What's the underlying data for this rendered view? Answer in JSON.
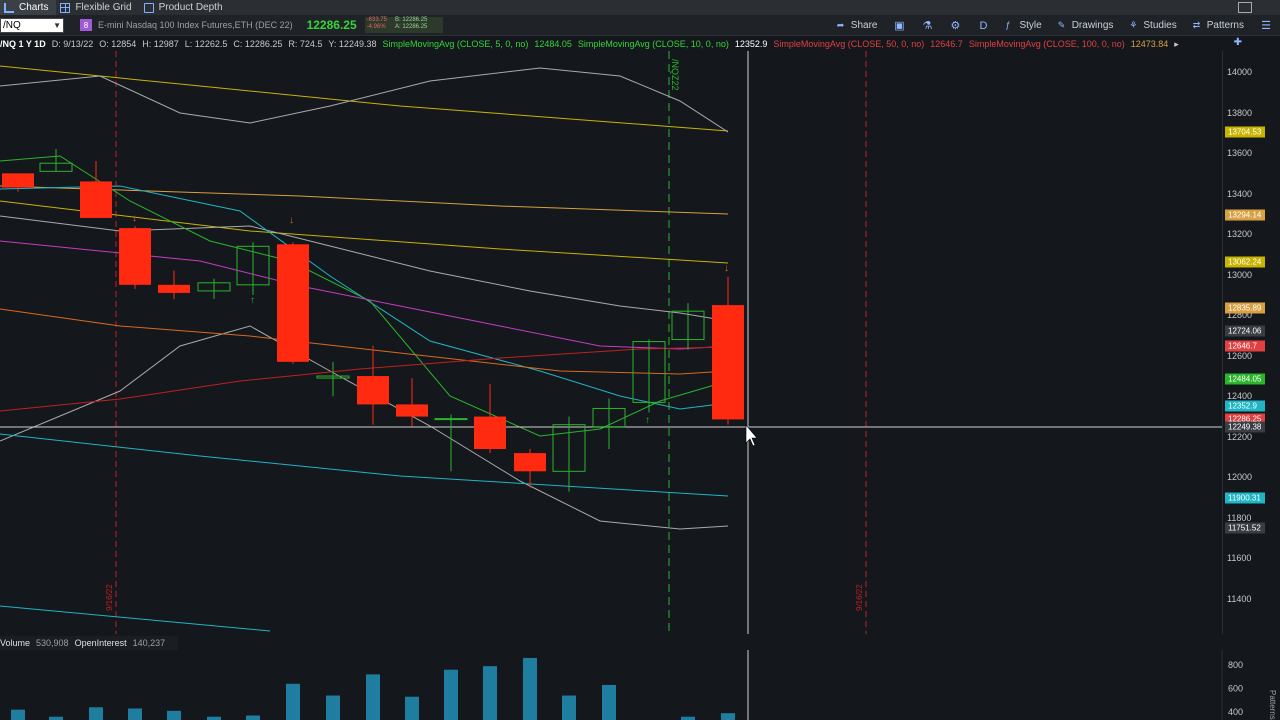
{
  "tabs": [
    {
      "label": "Charts",
      "active": true
    },
    {
      "label": "Flexible Grid",
      "active": false
    },
    {
      "label": "Product Depth",
      "active": false
    }
  ],
  "toolbar": {
    "symbol": "/NQ",
    "link_label": "8",
    "description": "E-mini Nasdaq 100 Index Futures,ETH (DEC 22)",
    "last_price": "12286.25",
    "bid_change_top": "-633.75",
    "bid_change_bottom": "-4.96%",
    "bid": "B: 12286.25",
    "ask": "A: 12286.25",
    "share_label": "Share",
    "period_label": "D",
    "style_label": "Style",
    "drawings_label": "Drawings",
    "studies_label": "Studies",
    "patterns_label": "Patterns"
  },
  "legend": {
    "symbol_period": "/NQ 1 Y 1D",
    "date": "D: 9/13/22",
    "open": "O: 12854",
    "high": "H: 12987",
    "low": "L: 12262.5",
    "close": "C: 12286.25",
    "range": "R: 724.5",
    "ylow": "Y: 12249.38",
    "sma5_label": "SimpleMovingAvg (CLOSE, 5, 0, no)",
    "sma5_value": "12484.05",
    "sma10_label": "SimpleMovingAvg (CLOSE, 10, 0, no)",
    "sma10_value": "12352.9",
    "sma50_label": "SimpleMovingAvg (CLOSE, 50, 0, no)",
    "sma50_value": "12646.7",
    "sma100_label": "SimpleMovingAvg (CLOSE, 100, 0, no)",
    "sma100_value": "12473.84",
    "more": "▸"
  },
  "price_axis": {
    "labels": [
      "14000",
      "13800",
      "13600",
      "13400",
      "13200",
      "13000",
      "12800",
      "12600",
      "12400",
      "12200",
      "12000",
      "11800",
      "11600",
      "11400"
    ],
    "tags": [
      {
        "text": "13704.53",
        "price": 13704.53,
        "color": "#c8b400"
      },
      {
        "text": "13294.14",
        "price": 13294.14,
        "color": "#d8a040"
      },
      {
        "text": "13062.24",
        "price": 13062.24,
        "color": "#c8b400"
      },
      {
        "text": "12835.89",
        "price": 12835.89,
        "color": "#d8a040"
      },
      {
        "text": "12724.06",
        "price": 12724.06,
        "color": "#3a3e44"
      },
      {
        "text": "12646.7",
        "price": 12646.7,
        "color": "#e04040"
      },
      {
        "text": "12484.05",
        "price": 12484.05,
        "color": "#2ab52a"
      },
      {
        "text": "12352.9",
        "price": 12352.9,
        "color": "#1fb5c4"
      },
      {
        "text": "12286.25",
        "price": 12286.25,
        "color": "#e04040"
      },
      {
        "text": "12249.38",
        "price": 12249.38,
        "color": "#3a3e44"
      },
      {
        "text": "11900.31",
        "price": 11900.31,
        "color": "#1fb5c4"
      },
      {
        "text": "11751.52",
        "price": 11751.52,
        "color": "#3a3e44"
      }
    ]
  },
  "markers": {
    "expiry_label": "/NQZ22",
    "date_left": "9/16/22",
    "date_right": "9/16/22"
  },
  "volume": {
    "name": "Volume",
    "value": "530,908",
    "oi_name": "OpenInterest",
    "oi_value": "140,237",
    "axis_labels": [
      "800",
      "600",
      "400"
    ],
    "axis_values": [
      800,
      600,
      400
    ],
    "bars": [
      {
        "pos": 18,
        "v": 420
      },
      {
        "pos": 56,
        "v": 360
      },
      {
        "pos": 96,
        "v": 440
      },
      {
        "pos": 135,
        "v": 430
      },
      {
        "pos": 174,
        "v": 410
      },
      {
        "pos": 214,
        "v": 360
      },
      {
        "pos": 253,
        "v": 370
      },
      {
        "pos": 293,
        "v": 640
      },
      {
        "pos": 333,
        "v": 540
      },
      {
        "pos": 373,
        "v": 720
      },
      {
        "pos": 412,
        "v": 530
      },
      {
        "pos": 451,
        "v": 760
      },
      {
        "pos": 490,
        "v": 790
      },
      {
        "pos": 530,
        "v": 860
      },
      {
        "pos": 569,
        "v": 540
      },
      {
        "pos": 609,
        "v": 630
      },
      {
        "pos": 688,
        "v": 360
      },
      {
        "pos": 728,
        "v": 390
      }
    ],
    "pattern_label": "Patterns"
  },
  "colors": {
    "bull": "#2ab52a",
    "bear": "#ff2a10",
    "sma5": "#2ab52a",
    "sma10": "#1fb5c4",
    "sma50": "#c43cc4",
    "sma100": "#d86a20",
    "volume_bar": "#1f7ea0"
  },
  "candles": [
    {
      "o": 13430,
      "h": 13460,
      "l": 13410,
      "c": 13500,
      "up": false,
      "pos": 18
    },
    {
      "o": 13550,
      "h": 13620,
      "l": 13510,
      "c": 13510,
      "up": true,
      "pos": 56
    },
    {
      "o": 13460,
      "h": 13560,
      "l": 13280,
      "c": 13280,
      "up": false,
      "pos": 96
    },
    {
      "o": 13230,
      "h": 13240,
      "l": 12930,
      "c": 12950,
      "up": false,
      "pos": 135
    },
    {
      "o": 12950,
      "h": 13020,
      "l": 12880,
      "c": 12910,
      "up": false,
      "pos": 174
    },
    {
      "o": 12920,
      "h": 12980,
      "l": 12880,
      "c": 12960,
      "up": true,
      "pos": 214
    },
    {
      "o": 12950,
      "h": 13160,
      "l": 12900,
      "c": 13140,
      "up": true,
      "pos": 253
    },
    {
      "o": 13150,
      "h": 13160,
      "l": 12560,
      "c": 12570,
      "up": false,
      "pos": 293
    },
    {
      "o": 12490,
      "h": 12570,
      "l": 12400,
      "c": 12500,
      "up": true,
      "pos": 333
    },
    {
      "o": 12500,
      "h": 12650,
      "l": 12260,
      "c": 12360,
      "up": false,
      "pos": 373
    },
    {
      "o": 12360,
      "h": 12490,
      "l": 12250,
      "c": 12300,
      "up": false,
      "pos": 412
    },
    {
      "o": 12290,
      "h": 12310,
      "l": 12030,
      "c": 12290,
      "up": true,
      "pos": 451
    },
    {
      "o": 12300,
      "h": 12460,
      "l": 12120,
      "c": 12140,
      "up": false,
      "pos": 490
    },
    {
      "o": 12120,
      "h": 12140,
      "l": 11950,
      "c": 12030,
      "up": false,
      "pos": 530
    },
    {
      "o": 12030,
      "h": 12300,
      "l": 11930,
      "c": 12260,
      "up": true,
      "pos": 569
    },
    {
      "o": 12250,
      "h": 12390,
      "l": 12140,
      "c": 12340,
      "up": true,
      "pos": 609
    },
    {
      "o": 12370,
      "h": 12680,
      "l": 12320,
      "c": 12670,
      "up": true,
      "pos": 649
    },
    {
      "o": 12680,
      "h": 12860,
      "l": 12630,
      "c": 12820,
      "up": true,
      "pos": 688
    },
    {
      "o": 12850,
      "h": 12990,
      "l": 12260,
      "c": 12286,
      "up": false,
      "pos": 728
    }
  ]
}
